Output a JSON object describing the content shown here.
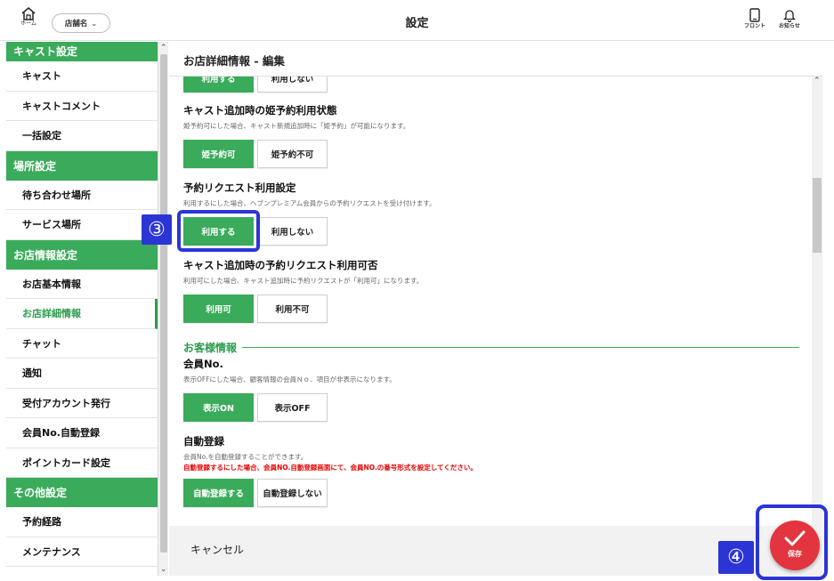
{
  "header": {
    "home_label": "ホーム",
    "store_select_value": "店舗名",
    "title": "設定",
    "front_label": "フロント",
    "notice_label": "お知らせ"
  },
  "sidebar": {
    "sections": [
      {
        "title": "キャスト設定",
        "items": [
          "キャスト",
          "キャストコメント",
          "一括設定"
        ]
      },
      {
        "title": "場所設定",
        "items": [
          "待ち合わせ場所",
          "サービス場所"
        ]
      },
      {
        "title": "お店情報設定",
        "items": [
          "お店基本情報",
          "お店詳細情報",
          "チャット",
          "通知",
          "受付アカウント発行",
          "会員No.自動登録",
          "ポイントカード設定"
        ]
      },
      {
        "title": "その他設定",
        "items": [
          "予約経路",
          "メンテナンス"
        ]
      }
    ],
    "active_item": "お店詳細情報"
  },
  "panel": {
    "title": "お店詳細情報 - 編集",
    "partial_buttons": [
      "利用する",
      "利用しない"
    ],
    "fields": [
      {
        "title": "キャスト追加時の姫予約利用状態",
        "desc": "姫予約可にした場合、キャスト新規追加時に「姫予約」が可能になります。",
        "options": [
          "姫予約可",
          "姫予約不可"
        ]
      },
      {
        "title": "予約リクエスト利用設定",
        "desc": "利用するにした場合、ヘブンプレミアム会員からの予約リクエストを受け付けます。",
        "options": [
          "利用する",
          "利用しない"
        ]
      },
      {
        "title": "キャスト追加時の予約リクエスト利用可否",
        "desc": "利用可にした場合、キャスト追加時に予約リクエストが「利用可」になります。",
        "options": [
          "利用可",
          "利用不可"
        ]
      }
    ],
    "customer_section_label": "お客様情報",
    "customer_fields": [
      {
        "title": "会員No.",
        "desc": "表示OFFにした場合、顧客情報の会員Ｎｏ．項目が非表示になります。",
        "options": [
          "表示ON",
          "表示OFF"
        ]
      },
      {
        "title": "自動登録",
        "desc": "会員No.を自動登録することができます。",
        "warning": "自動登録するにした場合、会員NO.自動登録画面にて、会員NO.の番号形式を設定してください。",
        "options": [
          "自動登録する",
          "自動登録しない"
        ]
      }
    ]
  },
  "footer": {
    "cancel_label": "キャンセル",
    "save_label": "保存"
  },
  "annotations": {
    "step3": "③",
    "step4": "④"
  },
  "colors": {
    "accent_green": "#3aab5a",
    "annotation_blue": "#2b35d6",
    "save_red": "#e2353f",
    "warning_red": "#e60000"
  }
}
